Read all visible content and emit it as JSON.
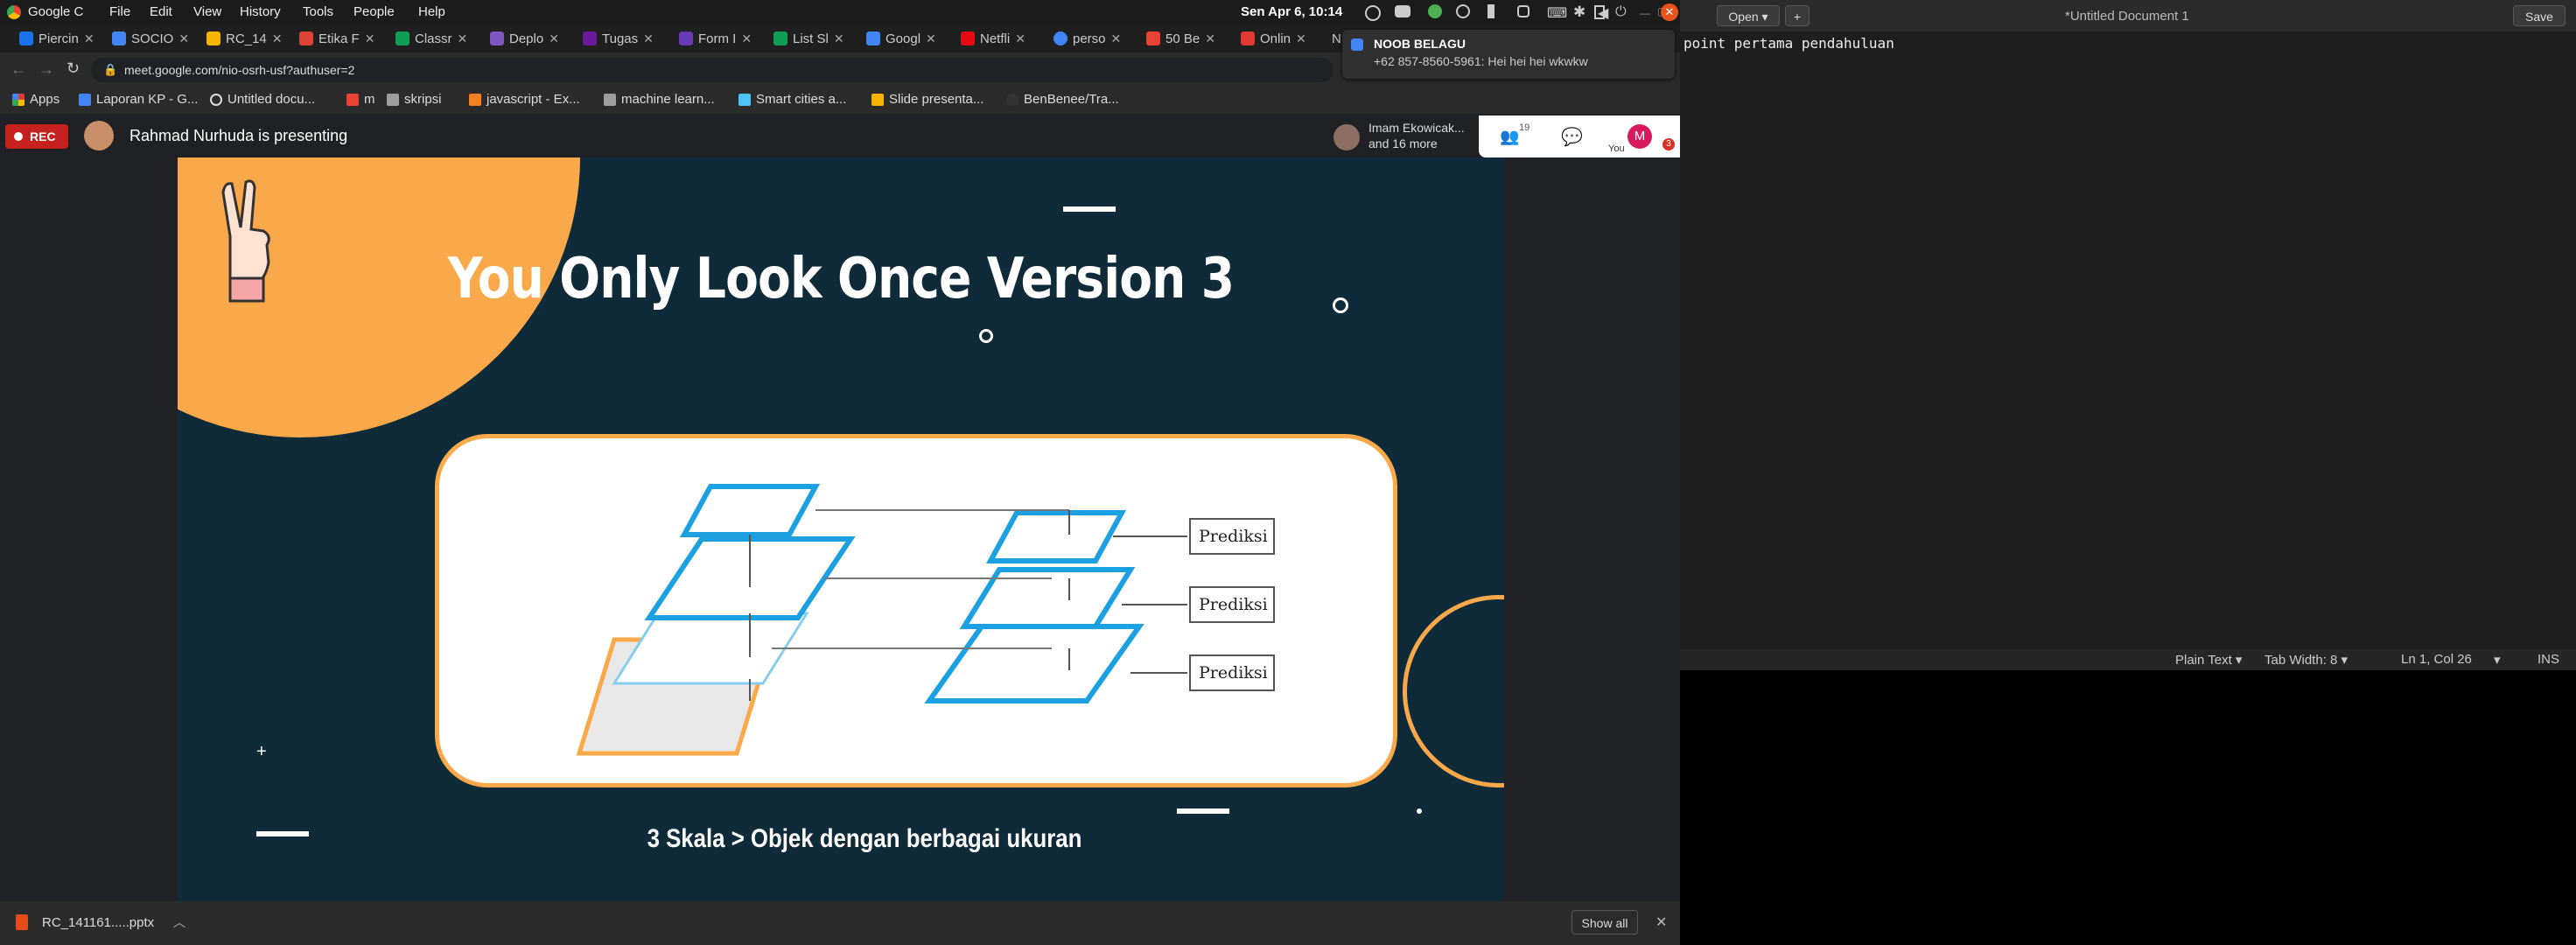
{
  "system_bar": {
    "app_name": "Google C",
    "menus": [
      "File",
      "Edit",
      "View",
      "History",
      "Tools",
      "People",
      "Help"
    ],
    "clock": "Sen Apr  6, 10:14"
  },
  "tabs": [
    {
      "label": "Piercin",
      "color": "#1a73e8"
    },
    {
      "label": "SOCIO",
      "color": "#4285f4"
    },
    {
      "label": "RC_14",
      "color": "#f4b400"
    },
    {
      "label": "Etika F",
      "color": "#db4437"
    },
    {
      "label": "Classr",
      "color": "#0f9d58"
    },
    {
      "label": "Deplo",
      "color": "#7e57c2"
    },
    {
      "label": "Tugas",
      "color": "#6a1b9a"
    },
    {
      "label": "Form I",
      "color": "#673ab7"
    },
    {
      "label": "List Sl",
      "color": "#0f9d58"
    },
    {
      "label": "Googl",
      "color": "#4285f4"
    },
    {
      "label": "Netfli",
      "color": "#e50914"
    },
    {
      "label": "perso",
      "color": "#4285f4"
    },
    {
      "label": "50 Be",
      "color": "#ea4335"
    },
    {
      "label": "Onlin",
      "color": "#e53935"
    },
    {
      "label": "N",
      "color": "#888888"
    }
  ],
  "address": {
    "url": "meet.google.com/nio-osrh-usf?authuser=2"
  },
  "bookmarks": [
    {
      "label": "Apps",
      "color": "#e53935"
    },
    {
      "label": "Laporan KP - G...",
      "color": "#4285f4"
    },
    {
      "label": "Untitled docu...",
      "color": "#dddddd"
    },
    {
      "label": "m",
      "color": "#ea4335"
    },
    {
      "label": "skripsi",
      "color": "#9e9e9e"
    },
    {
      "label": "javascript - Ex...",
      "color": "#f48024"
    },
    {
      "label": "machine learn...",
      "color": "#9e9e9e"
    },
    {
      "label": "Smart cities a...",
      "color": "#4fc3f7"
    },
    {
      "label": "Slide presenta...",
      "color": "#f4b400"
    },
    {
      "label": "BenBenee/Tra...",
      "color": "#333333"
    }
  ],
  "notification": {
    "title": "NOOB BELAGU",
    "body": "+62 857-8560-5961: Hei hei hei wkwkw"
  },
  "meet": {
    "rec_label": "REC",
    "presenter_text": "Rahmad Nurhuda is presenting",
    "participants_text": "Imam Ekowicak... and 16 more",
    "participants_line1": "Imam Ekowicak...",
    "participants_line2": "and 16 more",
    "people_count": "19",
    "you_label": "You",
    "avatar_letter": "M",
    "badge_count": "3"
  },
  "slide": {
    "title": "You Only Look Once Version 3",
    "caption": "3 Skala > Objek dengan berbagai ukuran",
    "predictions": [
      "Prediksi",
      "Prediksi",
      "Prediksi"
    ]
  },
  "download": {
    "file": "RC_141161.....pptx",
    "show_all": "Show all"
  },
  "gedit": {
    "open_label": "Open",
    "title": "*Untitled Document 1",
    "save_label": "Save",
    "content": "point pertama pendahuluan",
    "status_lang": "Plain Text",
    "status_tab": "Tab Width: 8",
    "status_pos": "Ln 1, Col 26",
    "status_ins": "INS"
  }
}
